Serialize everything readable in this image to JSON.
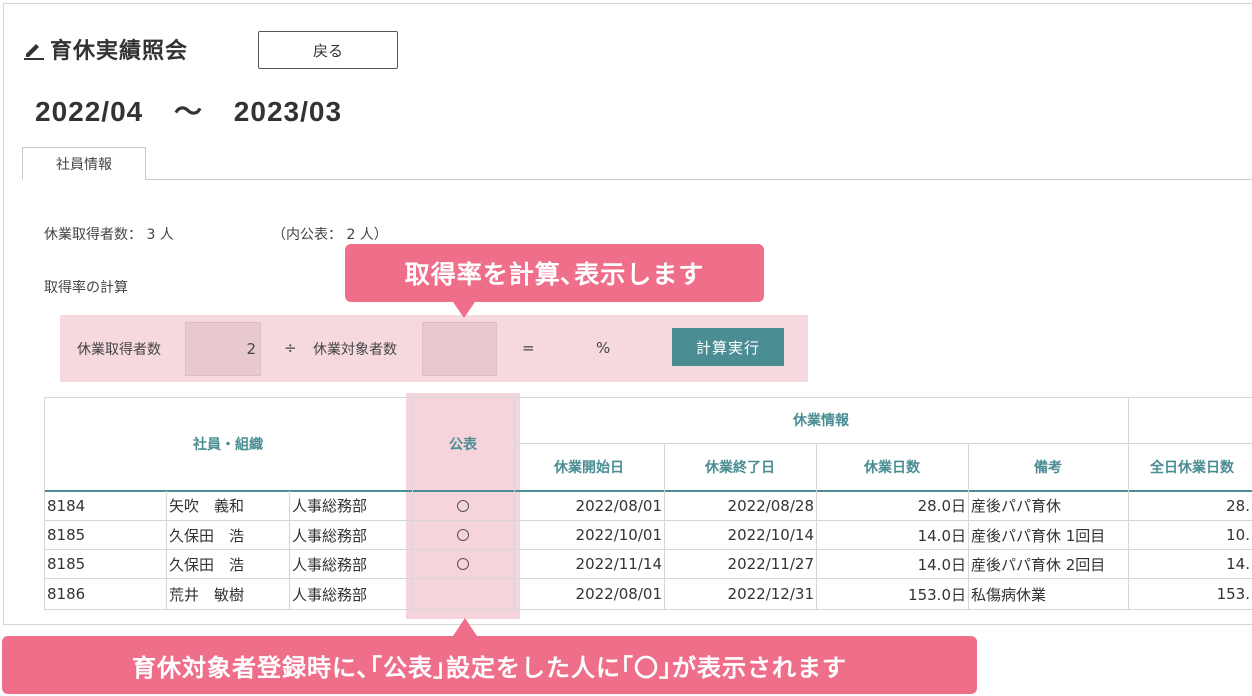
{
  "header": {
    "title": "育休実績照会",
    "back_label": "戻る",
    "period_start": "2022/04",
    "period_sep": "〜",
    "period_end": "2023/03"
  },
  "tabs": [
    {
      "label": "社員情報"
    }
  ],
  "summary": {
    "takers_text": "休業取得者数： 3 人",
    "public_text": "（内公表： 2 人）"
  },
  "calc": {
    "section_label": "取得率の計算",
    "takers_label": "休業取得者数",
    "takers_value": "2",
    "divide": "÷",
    "targets_label": "休業対象者数",
    "targets_value": "",
    "equals": "=",
    "percent": "%",
    "run_label": "計算実行"
  },
  "table": {
    "headers": {
      "employee_org": "社員・組織",
      "public": "公表",
      "leave_info": "休業情報",
      "start": "休業開始日",
      "end": "休業終了日",
      "days": "休業日数",
      "note": "備考",
      "full_days": "全日休業日数"
    },
    "rows": [
      {
        "id": "8184",
        "name": "矢吹　義和",
        "dept": "人事総務部",
        "public": true,
        "start": "2022/08/01",
        "end": "2022/08/28",
        "days": "28.0日",
        "note": "産後パパ育休",
        "full_days": "28."
      },
      {
        "id": "8185",
        "name": "久保田　浩",
        "dept": "人事総務部",
        "public": true,
        "start": "2022/10/01",
        "end": "2022/10/14",
        "days": "14.0日",
        "note": "産後パパ育休 1回目",
        "full_days": "10."
      },
      {
        "id": "8185",
        "name": "久保田　浩",
        "dept": "人事総務部",
        "public": true,
        "start": "2022/11/14",
        "end": "2022/11/27",
        "days": "14.0日",
        "note": "産後パパ育休 2回目",
        "full_days": "14."
      },
      {
        "id": "8186",
        "name": "荒井　敏樹",
        "dept": "人事総務部",
        "public": false,
        "start": "2022/08/01",
        "end": "2022/12/31",
        "days": "153.0日",
        "note": "私傷病休業",
        "full_days": "153."
      }
    ]
  },
  "callouts": {
    "top": "取得率を計算､表示します",
    "bottom": "育休対象者登録時に､｢公表｣設定をした人に｢〇｣が表示されます"
  },
  "colors": {
    "accent_teal": "#4a8d93",
    "callout_pink": "#ef6f8a",
    "highlight_pink": "#f6d9df"
  },
  "icons": {
    "title_icon": "pencil-icon",
    "public_mark": "circle-icon"
  }
}
